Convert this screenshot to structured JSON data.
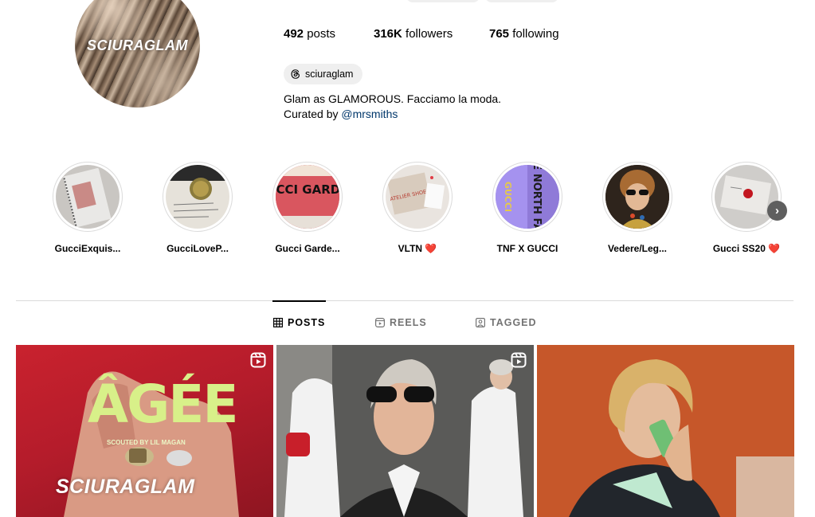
{
  "profile": {
    "avatar_text": "SCIURAGLAM",
    "stats": {
      "posts_value": "492",
      "posts_label": "posts",
      "followers_value": "316K",
      "followers_label": "followers",
      "following_value": "765",
      "following_label": "following"
    },
    "threads_handle": "sciuraglam",
    "bio_line1": "Glam as GLAMOROUS. Facciamo la moda.",
    "bio_line2_prefix": "Curated by",
    "bio_mention": "@mrsmiths"
  },
  "highlights": [
    {
      "label": "GucciExquis..."
    },
    {
      "label": "GucciLoveP..."
    },
    {
      "label": "Gucci Garde..."
    },
    {
      "label": "VLTN ❤️"
    },
    {
      "label": "TNF X GUCCI"
    },
    {
      "label": "Vedere/Leg..."
    },
    {
      "label": "Gucci SS20 ❤️"
    }
  ],
  "highlight_art": {
    "garden_text": "GUCCI GARDEN",
    "atelier_text": "ATELIER SHOES",
    "tnf_text": "THE NORTH FACE",
    "tnf_gucci_text": "GUCCI"
  },
  "tabs": [
    {
      "label": "POSTS",
      "icon": "grid-icon",
      "active": true
    },
    {
      "label": "REELS",
      "icon": "reels-icon",
      "active": false
    },
    {
      "label": "TAGGED",
      "icon": "tagged-icon",
      "active": false
    }
  ],
  "posts": [
    {
      "overlay_title": "ÂGÉE",
      "overlay_sub": "SCOUTED BY LIL MAGAN",
      "overlay_brand": "SCIURAGLAM",
      "icon": "reel-icon"
    },
    {
      "icon": "reel-icon"
    },
    {}
  ],
  "colors": {
    "mention": "#00376b",
    "pill_bg": "#efefef",
    "divider": "#dbdbdb",
    "inactive_tab": "#737373",
    "agee_green": "#d8f089"
  }
}
